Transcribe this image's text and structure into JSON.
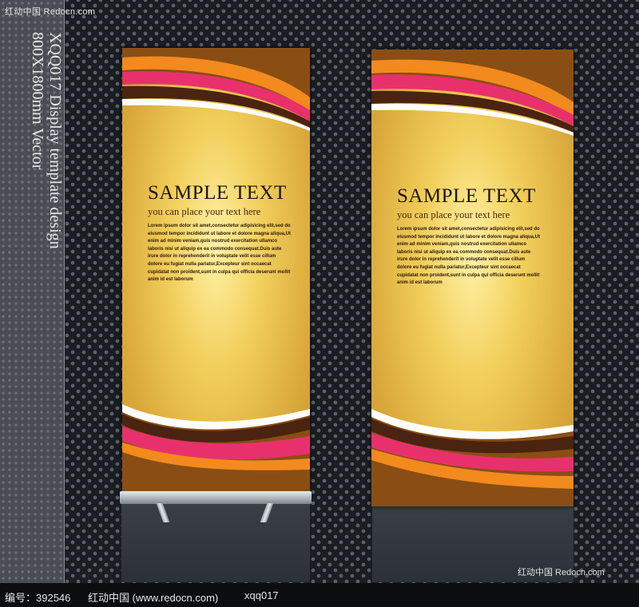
{
  "watermark": {
    "top_left": "红动中国  Redocn.com",
    "bottom_right": "红动中国 Redocn.com"
  },
  "side_title": {
    "line1": "XQQ017 Display template design",
    "line2": "800X1800mm Vector"
  },
  "banners": [
    {
      "headline": "SAMPLE TEXT",
      "subline": "you can place your text here",
      "body": "Lorem ipsum dolor sit amet,consectetur adipisicing elit,sed do eiusmod tempor incididunt ut labore et dolore magna aliqua,Ut enim ad minim veniam,quis nostrud exercitation ullamco laboris nisi ut aliquip ex ea commodo consequat.Duis aute irure dolor in reprehenderit in voluptate velit esse cillum dolore eu fugiat nulla pariatur,Excepteur sint occaecat cupidatat non proident,sunt in culpa qui officia deserunt mollit anim id est laborum"
    },
    {
      "headline": "SAMPLE TEXT",
      "subline": "you can place your text here",
      "body": "Lorem ipsum dolor sit amet,consectetur adipisicing elit,sed do eiusmod tempor incididunt ut labore et dolore magna aliqua,Ut enim ad minim veniam,quis nostrud exercitation ullamco laboris nisi ut aliquip ex ea commodo consequat.Duis aute irure dolor in reprehenderit in voluptate velit esse cillum dolore eu fugiat nulla pariatur,Excepteur sint occaecat cupidatat non proident,sunt in culpa qui officia deserunt mollit anim id est laborum"
    }
  ],
  "colors": {
    "brown": "#8a4e14",
    "dark_brown": "#4a2410",
    "orange": "#f28a1e",
    "pink": "#e8316c",
    "white": "#ffffff",
    "gold": "#e6bb4a"
  },
  "footer": {
    "id_label": "编号：392546",
    "site": "红动中国 (www.redocn.com)",
    "code": "xqq017"
  }
}
